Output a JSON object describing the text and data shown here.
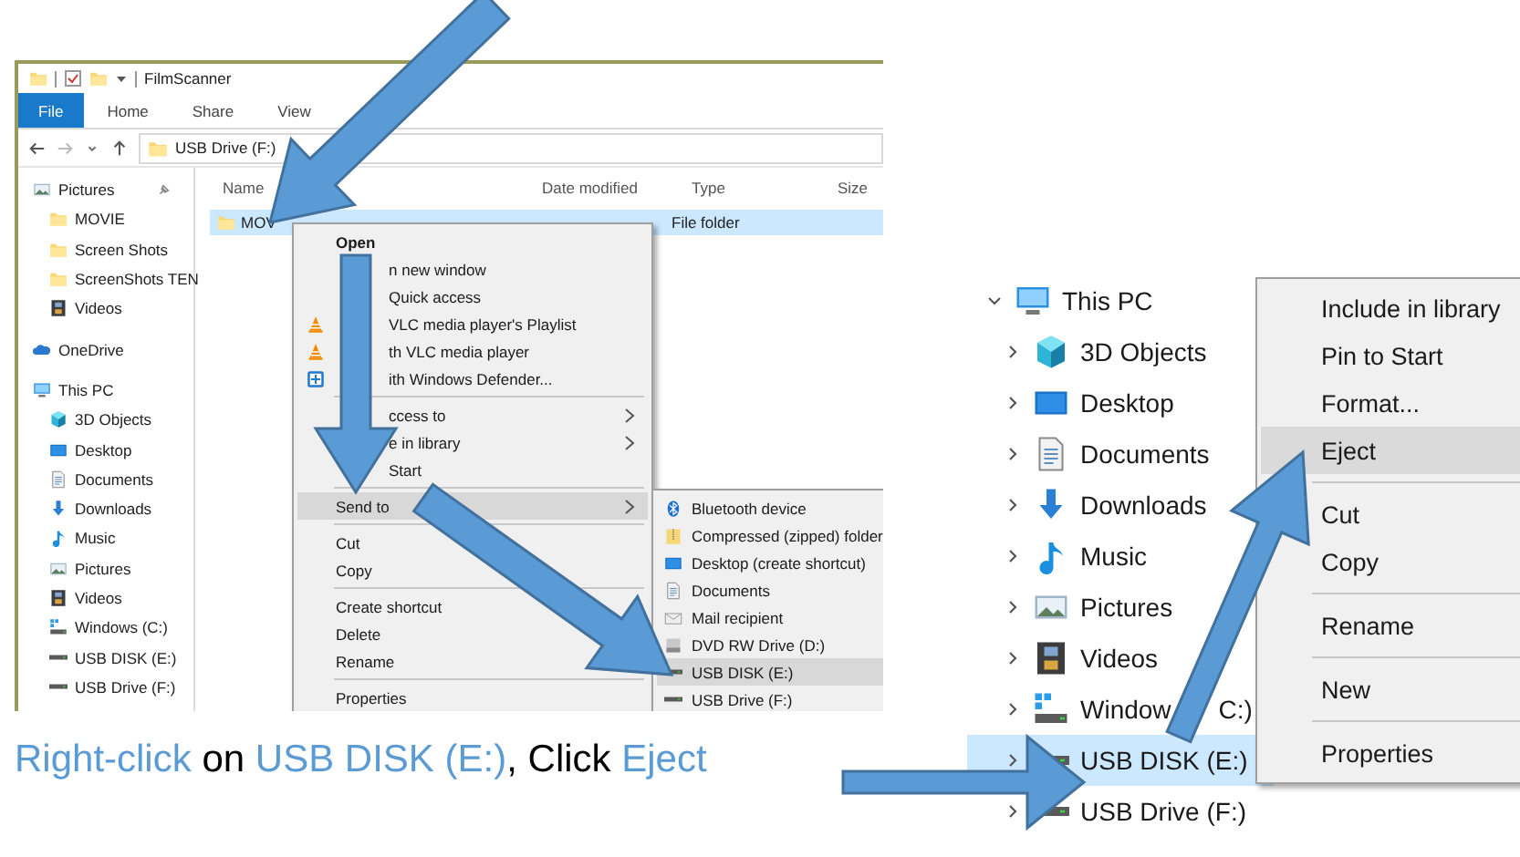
{
  "explorer": {
    "title": "FilmScanner",
    "ribbon_tabs": [
      {
        "label": "File",
        "selected": true
      },
      {
        "label": "Home",
        "selected": false
      },
      {
        "label": "Share",
        "selected": false
      },
      {
        "label": "View",
        "selected": false
      }
    ],
    "breadcrumb": [
      "USB Drive (F:)"
    ],
    "nav": [
      {
        "label": "Pictures",
        "kind": "pictures",
        "pinned": true
      },
      {
        "label": "MOVIE",
        "kind": "folder",
        "pinned": false
      },
      {
        "label": "Screen Shots",
        "kind": "folder",
        "pinned": false
      },
      {
        "label": "ScreenShots TEN",
        "kind": "folder",
        "pinned": false
      },
      {
        "label": "Videos",
        "kind": "video",
        "pinned": false
      },
      {
        "label": "OneDrive",
        "kind": "cloud",
        "pinned": false
      },
      {
        "label": "This PC",
        "kind": "computer",
        "pinned": false
      },
      {
        "label": "3D Objects",
        "kind": "cube",
        "pinned": false
      },
      {
        "label": "Desktop",
        "kind": "desktop",
        "pinned": false
      },
      {
        "label": "Documents",
        "kind": "document",
        "pinned": false
      },
      {
        "label": "Downloads",
        "kind": "download",
        "pinned": false
      },
      {
        "label": "Music",
        "kind": "music",
        "pinned": false
      },
      {
        "label": "Pictures",
        "kind": "pictures",
        "pinned": false
      },
      {
        "label": "Videos",
        "kind": "video",
        "pinned": false
      },
      {
        "label": "Windows (C:)",
        "kind": "system-drive",
        "pinned": false
      },
      {
        "label": "USB DISK (E:)",
        "kind": "drive",
        "pinned": false
      },
      {
        "label": "USB Drive (F:)",
        "kind": "drive",
        "pinned": false
      }
    ],
    "columns": [
      "Name",
      "Date modified",
      "Type",
      "Size"
    ],
    "rows": [
      {
        "name": "MOV",
        "type": "File folder",
        "selected": true
      }
    ],
    "context_menu": [
      {
        "kind": "default",
        "label": "Open",
        "selected": false,
        "covered": false
      },
      {
        "kind": "plain",
        "label": "n new window",
        "selected": false,
        "covered": true
      },
      {
        "kind": "plain",
        "label": "Quick access",
        "selected": false,
        "covered": true
      },
      {
        "kind": "vlc",
        "label": "VLC media player's Playlist",
        "selected": false,
        "covered": true
      },
      {
        "kind": "vlc",
        "label": "th VLC media player",
        "selected": false,
        "covered": true
      },
      {
        "kind": "shield",
        "label": "ith Windows Defender...",
        "selected": false,
        "covered": true
      },
      {
        "kind": "separator"
      },
      {
        "kind": "submenu",
        "label": "ccess to",
        "selected": false,
        "covered": true
      },
      {
        "kind": "submenu",
        "label": "e in library",
        "selected": false,
        "covered": true
      },
      {
        "kind": "plain",
        "label": "Start",
        "selected": false,
        "covered": true
      },
      {
        "kind": "separator"
      },
      {
        "kind": "submenu",
        "label": "Send to",
        "selected": true,
        "covered": false
      },
      {
        "kind": "separator"
      },
      {
        "kind": "plain",
        "label": "Cut",
        "selected": false,
        "covered": false
      },
      {
        "kind": "plain",
        "label": "Copy",
        "selected": false,
        "covered": false
      },
      {
        "kind": "separator"
      },
      {
        "kind": "plain",
        "label": "Create shortcut",
        "selected": false,
        "covered": false
      },
      {
        "kind": "plain",
        "label": "Delete",
        "selected": false,
        "covered": false
      },
      {
        "kind": "plain",
        "label": "Rename",
        "selected": false,
        "covered": false
      },
      {
        "kind": "separator"
      },
      {
        "kind": "plain",
        "label": "Properties",
        "selected": false,
        "covered": false
      }
    ],
    "send_to_menu": [
      {
        "kind": "bluetooth",
        "label": "Bluetooth device",
        "selected": false
      },
      {
        "kind": "zip",
        "label": "Compressed (zipped) folder",
        "selected": false
      },
      {
        "kind": "desktop",
        "label": "Desktop (create shortcut)",
        "selected": false
      },
      {
        "kind": "document",
        "label": "Documents",
        "selected": false
      },
      {
        "kind": "mail",
        "label": "Mail recipient",
        "selected": false
      },
      {
        "kind": "dvd",
        "label": "DVD RW Drive (D:)",
        "selected": false
      },
      {
        "kind": "drive",
        "label": "USB DISK (E:)",
        "selected": true
      },
      {
        "kind": "drive",
        "label": "USB Drive (F:)",
        "selected": false
      }
    ]
  },
  "tree": [
    {
      "kind": "computer",
      "label": "This PC",
      "expanded": true,
      "selected": false,
      "children": [
        {
          "kind": "cube",
          "label": "3D Objects",
          "expanded": false,
          "selected": false
        },
        {
          "kind": "desktop",
          "label": "Desktop",
          "expanded": false,
          "selected": false
        },
        {
          "kind": "document",
          "label": "Documents",
          "expanded": false,
          "selected": false
        },
        {
          "kind": "download",
          "label": "Downloads",
          "expanded": false,
          "selected": false
        },
        {
          "kind": "music",
          "label": "Music",
          "expanded": false,
          "selected": false
        },
        {
          "kind": "pictures",
          "label": "Pictures",
          "expanded": false,
          "selected": false
        },
        {
          "kind": "video",
          "label": "Videos",
          "expanded": false,
          "selected": false
        },
        {
          "kind": "system-drive",
          "label": "Window",
          "label_tail": "C:)",
          "expanded": false,
          "selected": false
        },
        {
          "kind": "drive",
          "label": "USB DISK (E:)",
          "expanded": false,
          "selected": true
        },
        {
          "kind": "drive",
          "label": "USB Drive (F:)",
          "expanded": false,
          "selected": false
        }
      ]
    }
  ],
  "drive_menu": [
    {
      "kind": "plain",
      "label": "Include in library",
      "selected": false
    },
    {
      "kind": "plain",
      "label": "Pin to Start",
      "selected": false
    },
    {
      "kind": "plain",
      "label": "Format...",
      "selected": false
    },
    {
      "kind": "plain",
      "label": "Eject",
      "selected": true
    },
    {
      "kind": "separator"
    },
    {
      "kind": "plain",
      "label": "Cut",
      "selected": false
    },
    {
      "kind": "plain",
      "label": "Copy",
      "selected": false
    },
    {
      "kind": "separator"
    },
    {
      "kind": "plain",
      "label": "Rename",
      "selected": false
    },
    {
      "kind": "separator"
    },
    {
      "kind": "plain",
      "label": "New",
      "selected": false
    },
    {
      "kind": "separator"
    },
    {
      "kind": "plain",
      "label": "Properties",
      "selected": false
    }
  ],
  "caption": [
    {
      "text": "Right-click",
      "highlight": true
    },
    {
      "text": "on",
      "highlight": false
    },
    {
      "text": "USB DISK (E:)",
      "highlight": true
    },
    {
      "text": ", Click",
      "highlight": false
    },
    {
      "text": "Eject",
      "highlight": true
    }
  ]
}
